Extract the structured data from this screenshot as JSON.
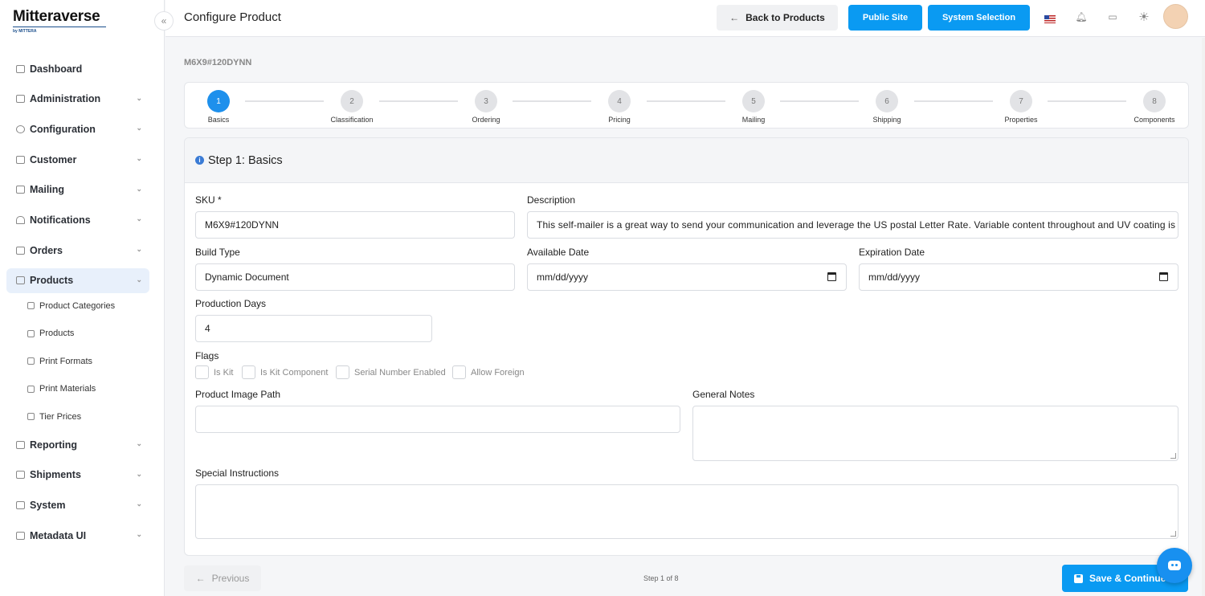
{
  "brand": {
    "name": "Mitteraverse",
    "tagline": "by MITTERA"
  },
  "sidebar": {
    "collapse_glyph": "«",
    "items": [
      {
        "label": "Dashboard",
        "icon": "chart-icon",
        "chevron": false
      },
      {
        "label": "Administration",
        "icon": "admin-icon",
        "chevron": true
      },
      {
        "label": "Configuration",
        "icon": "gear-icon",
        "chevron": true
      },
      {
        "label": "Customer",
        "icon": "building-icon",
        "chevron": true
      },
      {
        "label": "Mailing",
        "icon": "mail-icon",
        "chevron": true
      },
      {
        "label": "Notifications",
        "icon": "bell-icon",
        "chevron": true
      },
      {
        "label": "Orders",
        "icon": "cart-icon",
        "chevron": true
      },
      {
        "label": "Products",
        "icon": "box-icon",
        "chevron": true,
        "active": true
      }
    ],
    "sub_items": [
      {
        "label": "Product Categories",
        "icon": "tag-icon"
      },
      {
        "label": "Products",
        "icon": "box-icon"
      },
      {
        "label": "Print Formats",
        "icon": "document-icon"
      },
      {
        "label": "Print Materials",
        "icon": "layers-icon"
      },
      {
        "label": "Tier Prices",
        "icon": "price-icon"
      }
    ],
    "items_after": [
      {
        "label": "Reporting",
        "icon": "bar-chart-icon",
        "chevron": true
      },
      {
        "label": "Shipments",
        "icon": "truck-icon",
        "chevron": true
      },
      {
        "label": "System",
        "icon": "home-icon",
        "chevron": true
      },
      {
        "label": "Metadata UI",
        "icon": "grid-icon",
        "chevron": true
      }
    ]
  },
  "header": {
    "title": "Configure Product",
    "back_label": "Back to Products",
    "public_site_label": "Public Site",
    "system_selection_label": "System Selection"
  },
  "product": {
    "sku_heading": "M6X9#120DYNN"
  },
  "stepper": {
    "steps": [
      {
        "number": "1",
        "label": "Basics",
        "active": true
      },
      {
        "number": "2",
        "label": "Classification"
      },
      {
        "number": "3",
        "label": "Ordering"
      },
      {
        "number": "4",
        "label": "Pricing"
      },
      {
        "number": "5",
        "label": "Mailing"
      },
      {
        "number": "6",
        "label": "Shipping"
      },
      {
        "number": "7",
        "label": "Properties"
      },
      {
        "number": "8",
        "label": "Components"
      }
    ]
  },
  "form": {
    "section_title": "Step 1: Basics",
    "sku": {
      "label": "SKU *",
      "value": "M6X9#120DYNN"
    },
    "description": {
      "label": "Description",
      "value": "This self-mailer is a great way to send your communication and leverage the US postal Letter Rate. Variable content throughout and UV coating is"
    },
    "build_type": {
      "label": "Build Type",
      "value": "Dynamic Document"
    },
    "available_date": {
      "label": "Available Date",
      "placeholder": "mm/dd/yyyy"
    },
    "expiration_date": {
      "label": "Expiration Date",
      "placeholder": "mm/dd/yyyy"
    },
    "production_days": {
      "label": "Production Days",
      "value": "4"
    },
    "flags": {
      "label": "Flags",
      "options": [
        {
          "label": "Is Kit",
          "checked": false
        },
        {
          "label": "Is Kit Component",
          "checked": false
        },
        {
          "label": "Serial Number Enabled",
          "checked": false
        },
        {
          "label": "Allow Foreign",
          "checked": false
        }
      ]
    },
    "product_image_path": {
      "label": "Product Image Path",
      "value": ""
    },
    "general_notes": {
      "label": "General Notes",
      "value": ""
    },
    "special_instructions": {
      "label": "Special Instructions",
      "value": ""
    }
  },
  "footer": {
    "previous_label": "Previous",
    "step_counter": "Step 1 of 8",
    "save_label": "Save & Continue"
  },
  "colors": {
    "accent": "#0a9af2",
    "active_step": "#1e90ec",
    "sidebar_active_bg": "#e8f0fb"
  }
}
